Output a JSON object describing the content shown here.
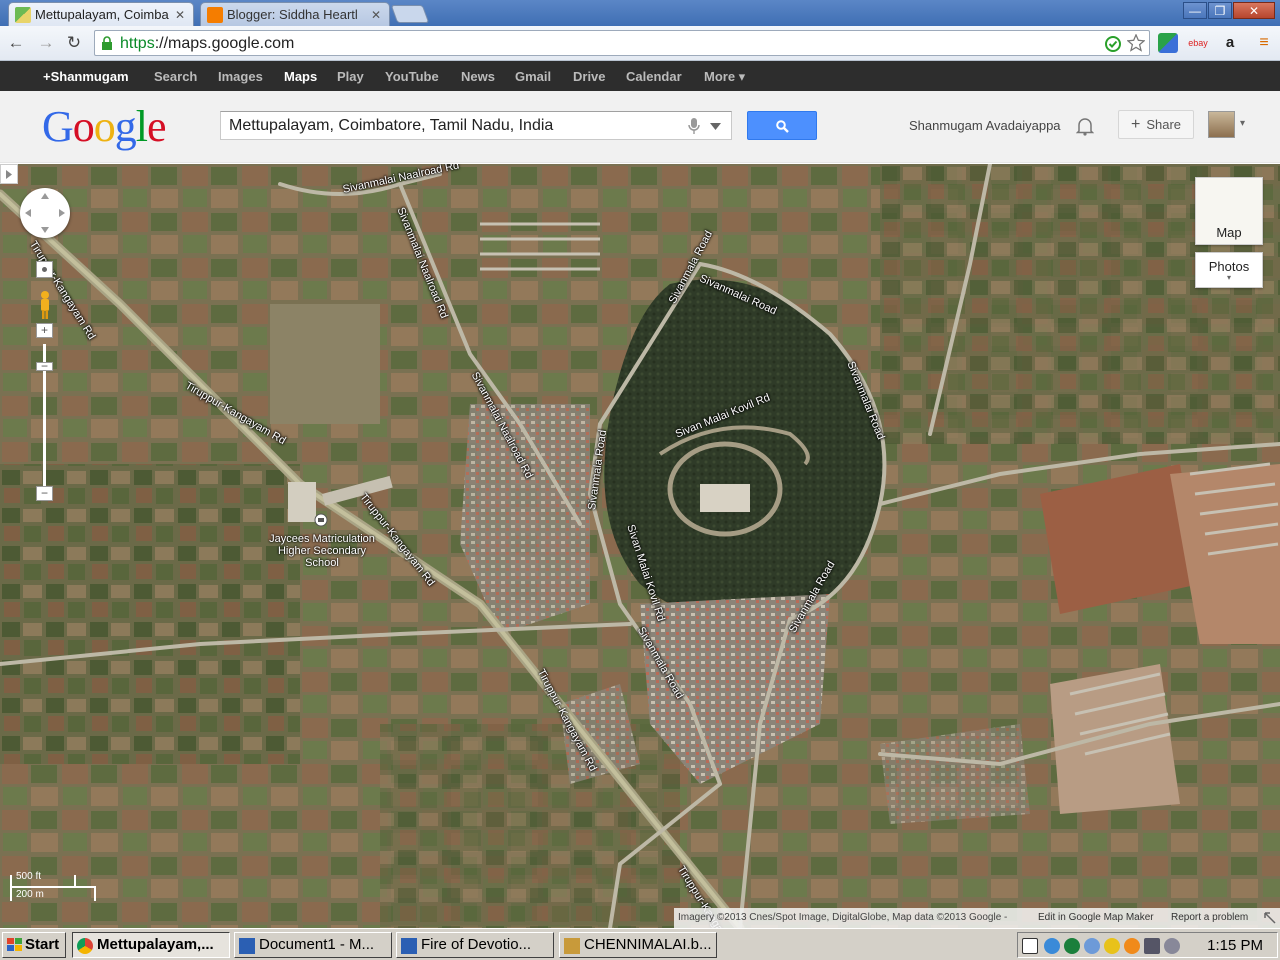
{
  "browser": {
    "tabs": [
      {
        "label": "Mettupalayam, Coimba",
        "close": "✕",
        "active": true
      },
      {
        "label": "Blogger: Siddha Heartl",
        "close": "✕",
        "active": false
      }
    ],
    "window_controls": {
      "minimize": "—",
      "maximize": "❐",
      "close": "✕"
    },
    "url_scheme": "https",
    "url_rest": "://maps.google.com",
    "nav": {
      "back": "←",
      "forward": "→",
      "reload": "↻"
    },
    "extensions": [
      "ebay",
      "a",
      "≡"
    ]
  },
  "google_bar": {
    "items": [
      "+Shanmugam",
      "Search",
      "Images",
      "Maps",
      "Play",
      "YouTube",
      "News",
      "Gmail",
      "Drive",
      "Calendar",
      "More ▾"
    ],
    "active": "Maps"
  },
  "header": {
    "logo_letters": [
      "G",
      "o",
      "o",
      "g",
      "l",
      "e"
    ],
    "search_value": "Mettupalayam, Coimbatore, Tamil Nadu, India",
    "username": "Shanmugam Avadaiyappa",
    "share_label": "Share",
    "share_plus": "+",
    "avatar_caret": "▾"
  },
  "map": {
    "road_labels": [
      "Sivanmalai Naalroad Rd",
      "Sivanmala Road",
      "Sivanmalai Road",
      "Sivan Malai Kovil Rd",
      "Sivanmala Road",
      "Sivan Malai Kovil Rd",
      "Sivanmalai Naalroad Rd",
      "Sivanmala Road",
      "Sivanmala Road",
      "Tiruppur-Kangayam Rd",
      "Tiruppur-Kangayam Rd",
      "Tiruppur-Kangayam Rd",
      "Tiruppur-Kangayam Rd",
      "Tiruppur-Kangayam Rd",
      "Tiruppur-Kangayam Rd"
    ],
    "poi_label": "Jaycees Matriculation Higher Secondary School",
    "map_button": "Map",
    "photos_button": "Photos",
    "photos_caret": "▾",
    "zoom_in": "+",
    "zoom_out": "−",
    "scale_ft": "500 ft",
    "scale_m": "200 m",
    "attribution": "Imagery ©2013 Cnes/Spot Image, DigitalGlobe, Map data ©2013 Google -",
    "edit_link": "Edit in Google Map Maker",
    "report_link": "Report a problem"
  },
  "taskbar": {
    "start_label": "Start",
    "tasks": [
      "Mettupalayam,...",
      "Document1 - M...",
      "Fire of Devotio...",
      "CHENNIMALAI.b..."
    ],
    "clock": "1:15 PM"
  },
  "colors": {
    "chrome_frame": "#3f6fb4",
    "google_bar": "#2d2d2d",
    "search_button": "#4d90fe",
    "satellite_base": "#6f6a4f",
    "hill_forest": "#2f3b28"
  }
}
